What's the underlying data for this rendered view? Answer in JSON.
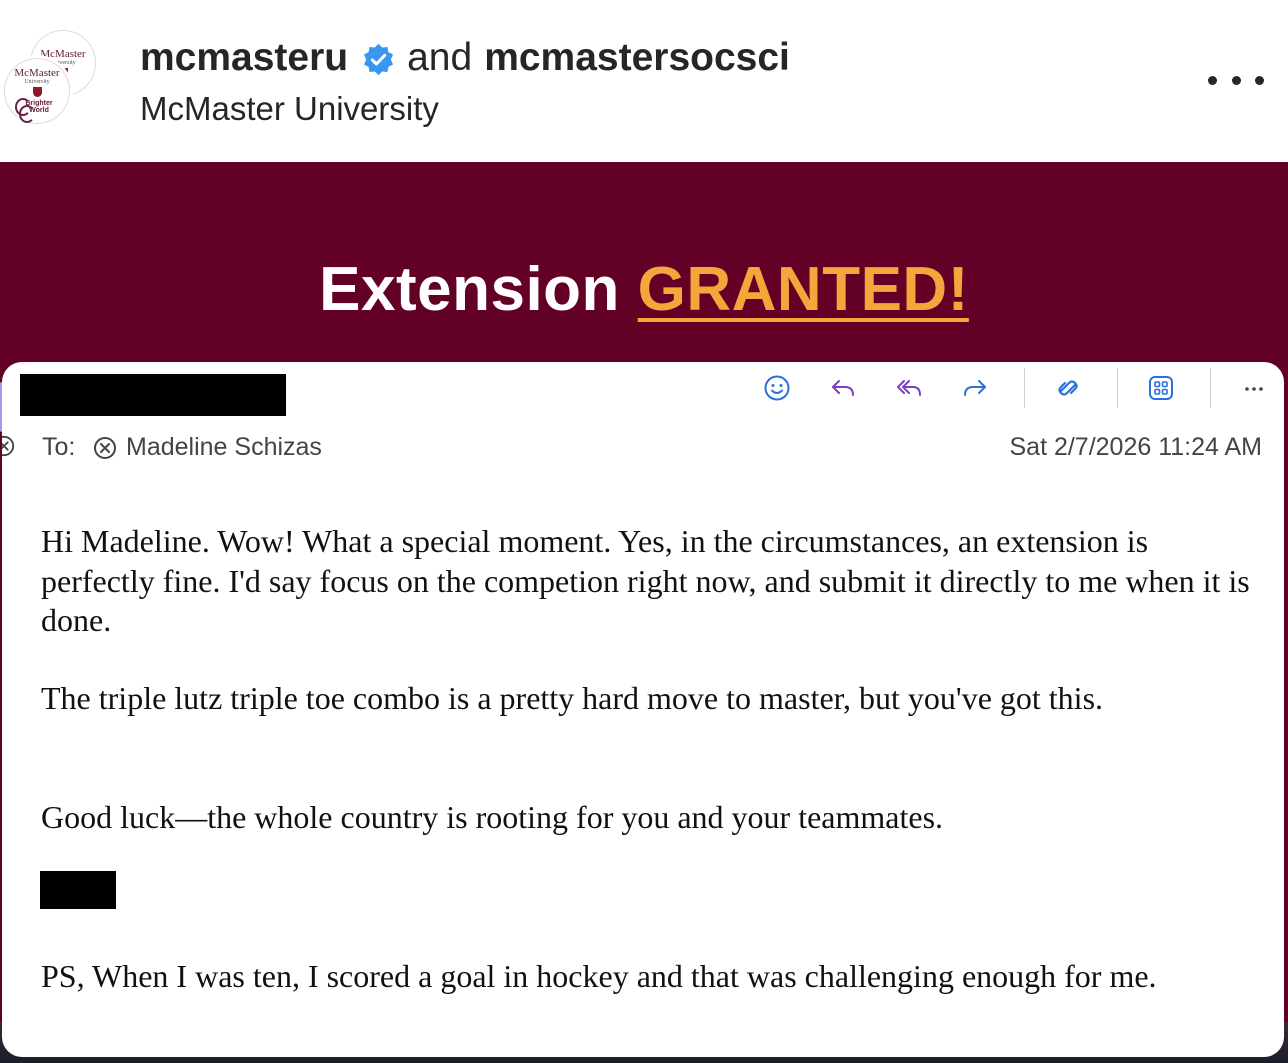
{
  "header": {
    "account_1": "mcmasteru",
    "conjunction": "and",
    "account_2": "mcmastersocsci",
    "subtitle": "McMaster University",
    "avatar_back": {
      "mc": "McMaster",
      "univ": "University"
    },
    "avatar_front": {
      "mc": "McMaster",
      "univ": "University",
      "brand_1": "Brighter",
      "brand_2": "World"
    },
    "verified_icon": "verified-badge-icon",
    "more_icon": "more-horizontal-icon",
    "colors": {
      "verified": "#3897f0",
      "text": "#262626"
    }
  },
  "post": {
    "headline_part1": "Extension",
    "headline_part2": "GRANTED!",
    "colors": {
      "background": "#620026",
      "headline": "#ffffff",
      "highlight": "#f4a63a"
    }
  },
  "email": {
    "toolbar_icons": [
      "emoji-icon",
      "reply-icon",
      "reply-all-icon",
      "forward-icon",
      "loop-icon",
      "apps-icon",
      "more-icon"
    ],
    "to_label": "To:",
    "recipient": "Madeline Schizas",
    "datetime": "Sat 2/7/2026 11:24 AM",
    "body_paragraph_1": "Hi Madeline.  Wow!  What a special moment.   Yes, in the circumstances, an extension is perfectly fine.  I'd say focus on the competion right now, and submit it directly to me when it is done.",
    "body_paragraph_2": "The triple lutz triple toe combo is a pretty hard move to master, but you've got this.",
    "body_paragraph_3": "Good luck—the whole country is rooting for you and your teammates.",
    "body_paragraph_4": "PS, When I was ten, I scored a goal in hockey and that was challenging enough for me.",
    "colors": {
      "toolbar_blue": "#2b72d6",
      "toolbar_purple": "#7a3fbf"
    }
  }
}
